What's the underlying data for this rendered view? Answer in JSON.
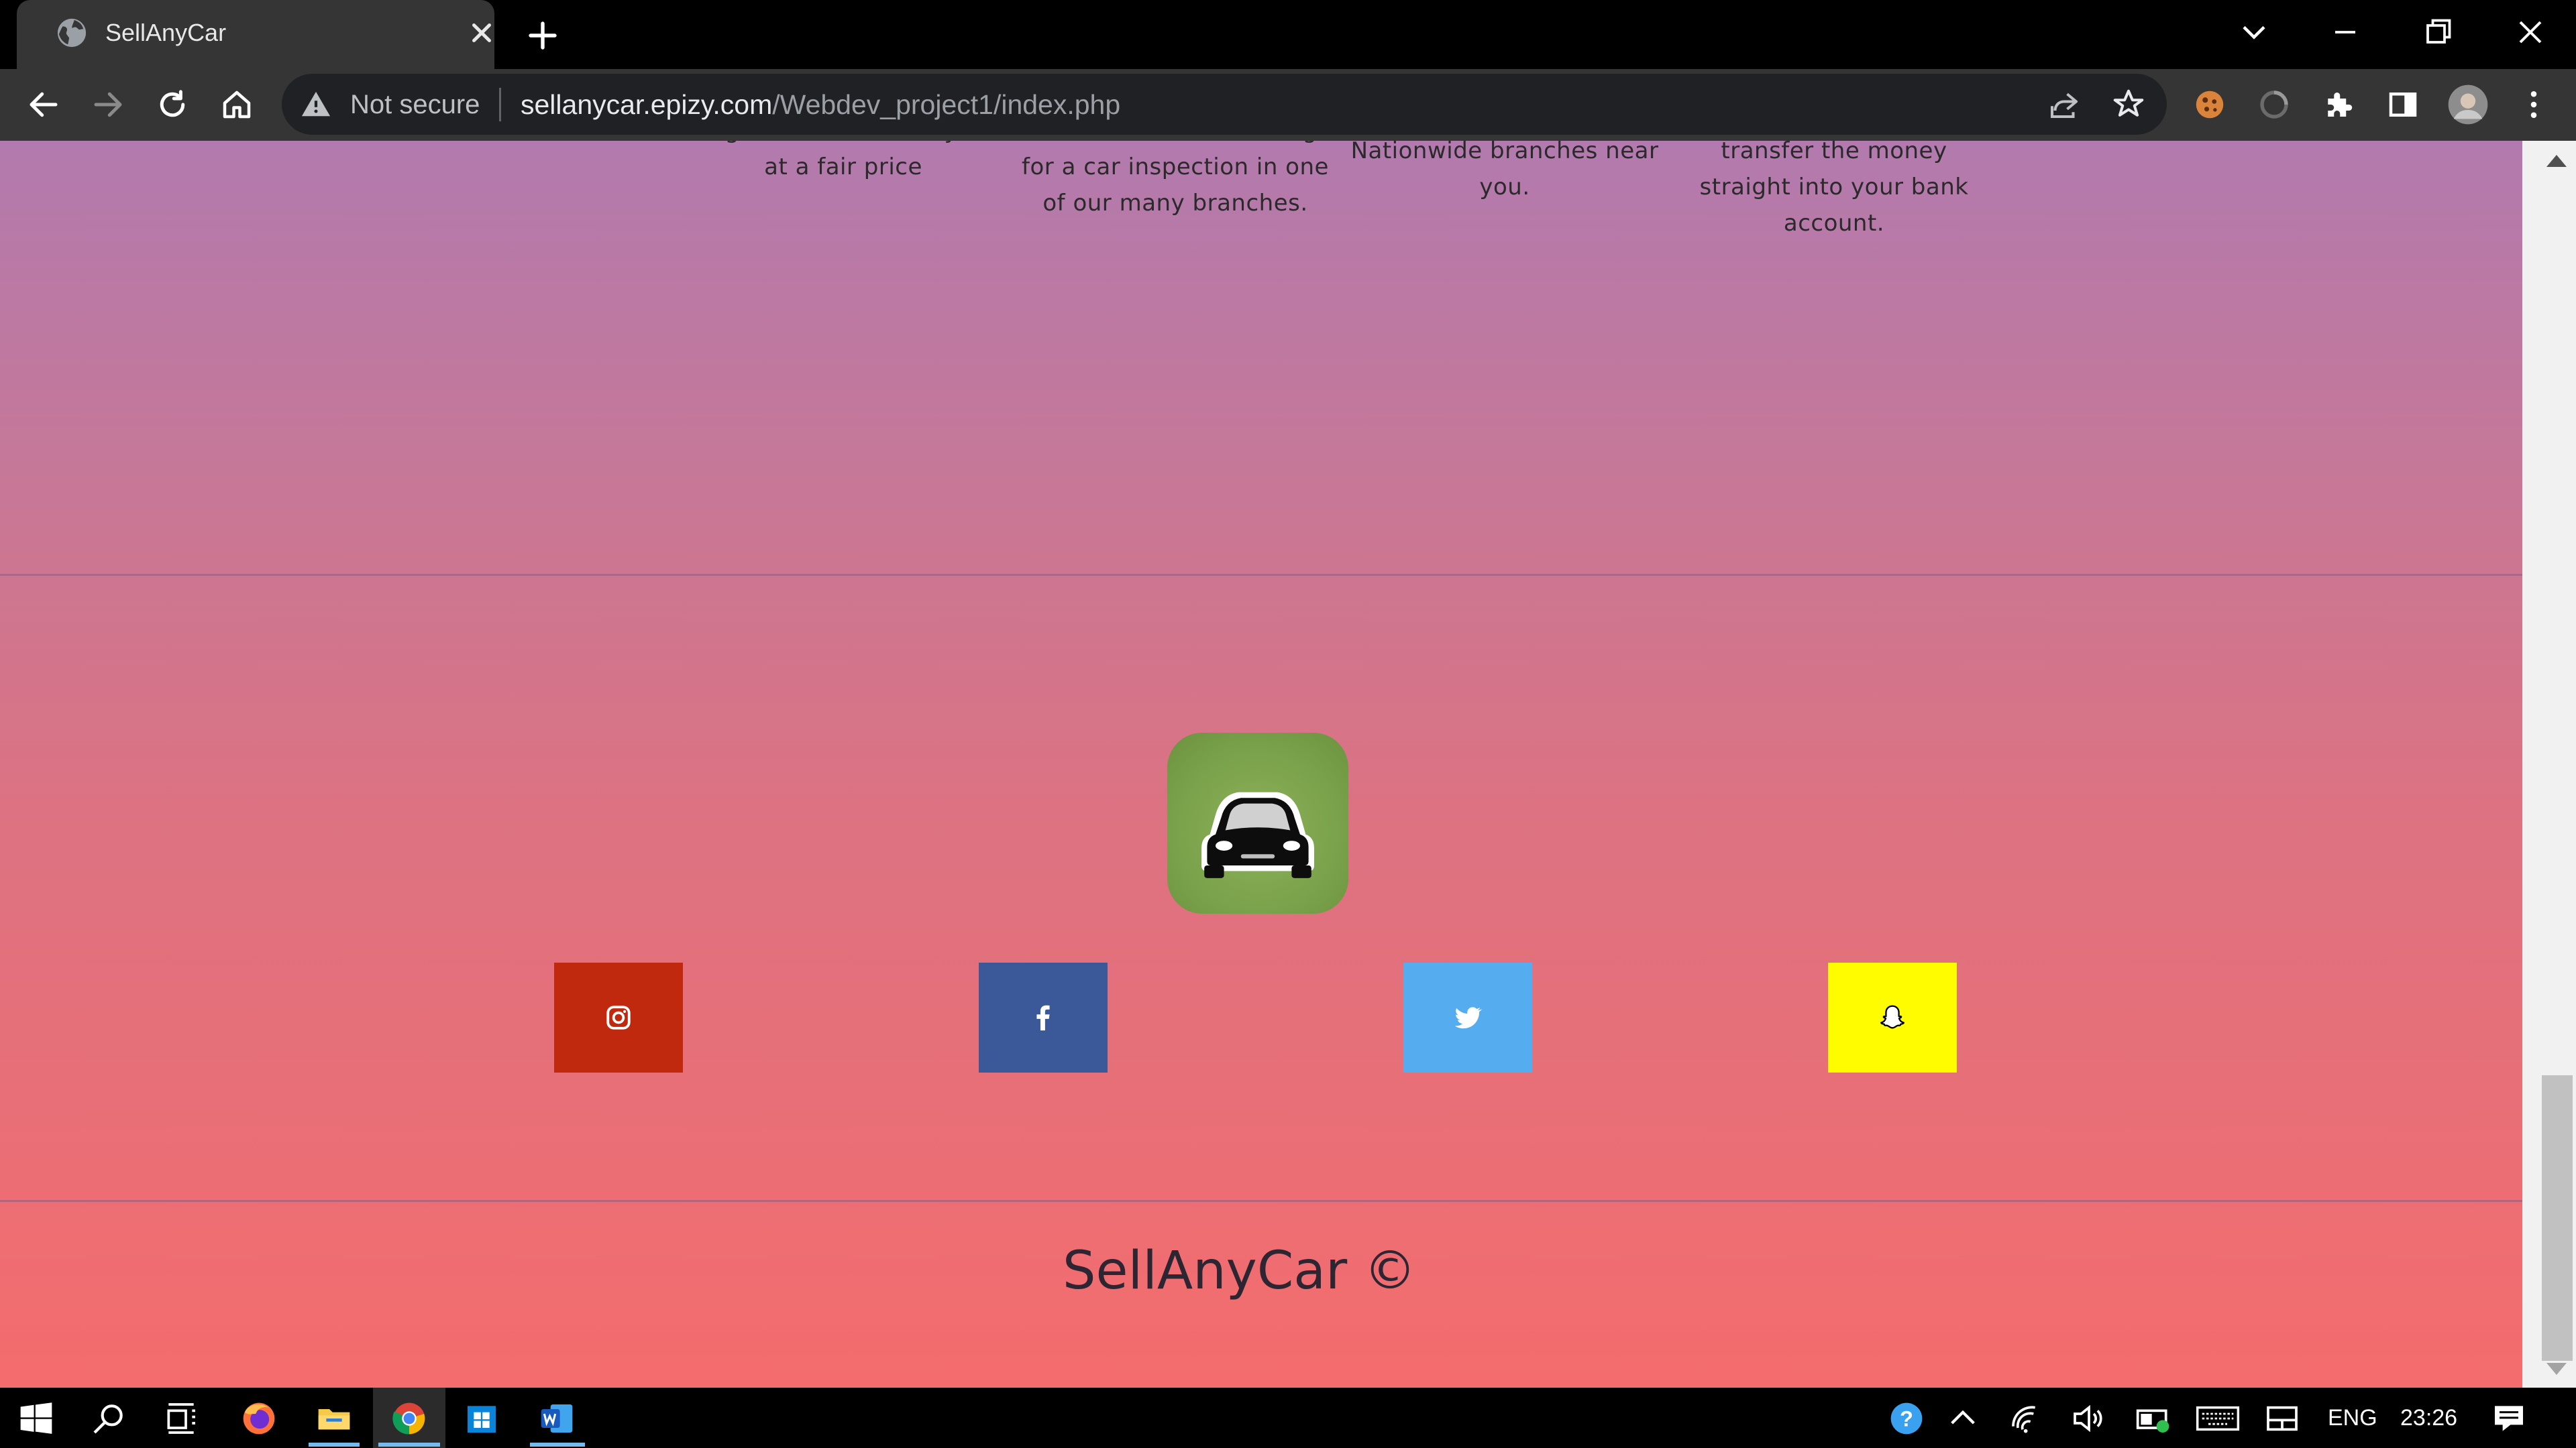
{
  "browser": {
    "tab_title": "SellAnyCar",
    "security_label": "Not secure",
    "url_host": "sellanycar.epizy.com",
    "url_path": "/Webdev_project1/index.php"
  },
  "page": {
    "steps": [
      {
        "text": "we get the best for any car at a fair price"
      },
      {
        "text": "Schedule a free booking for a car inspection in one of our many branches."
      },
      {
        "text": "Nationwide branches near you."
      },
      {
        "text": "transfer the money straight into your bank account."
      }
    ],
    "logo_icon": "car-icon",
    "social": [
      {
        "name": "instagram",
        "icon": "instagram-icon",
        "color": "#c1290f"
      },
      {
        "name": "facebook",
        "icon": "facebook-icon",
        "color": "#3b5998"
      },
      {
        "name": "twitter",
        "icon": "twitter-icon",
        "color": "#55acee"
      },
      {
        "name": "snapchat",
        "icon": "snapchat-icon",
        "color": "#fffc00"
      }
    ],
    "footer": "SellAnyCar ©"
  },
  "taskbar": {
    "language": "ENG",
    "time": "23:26"
  },
  "colors": {
    "page_gradient_top": "#b27aae",
    "page_gradient_bottom": "#f46c6d",
    "logo_green": "#7aa14b"
  }
}
